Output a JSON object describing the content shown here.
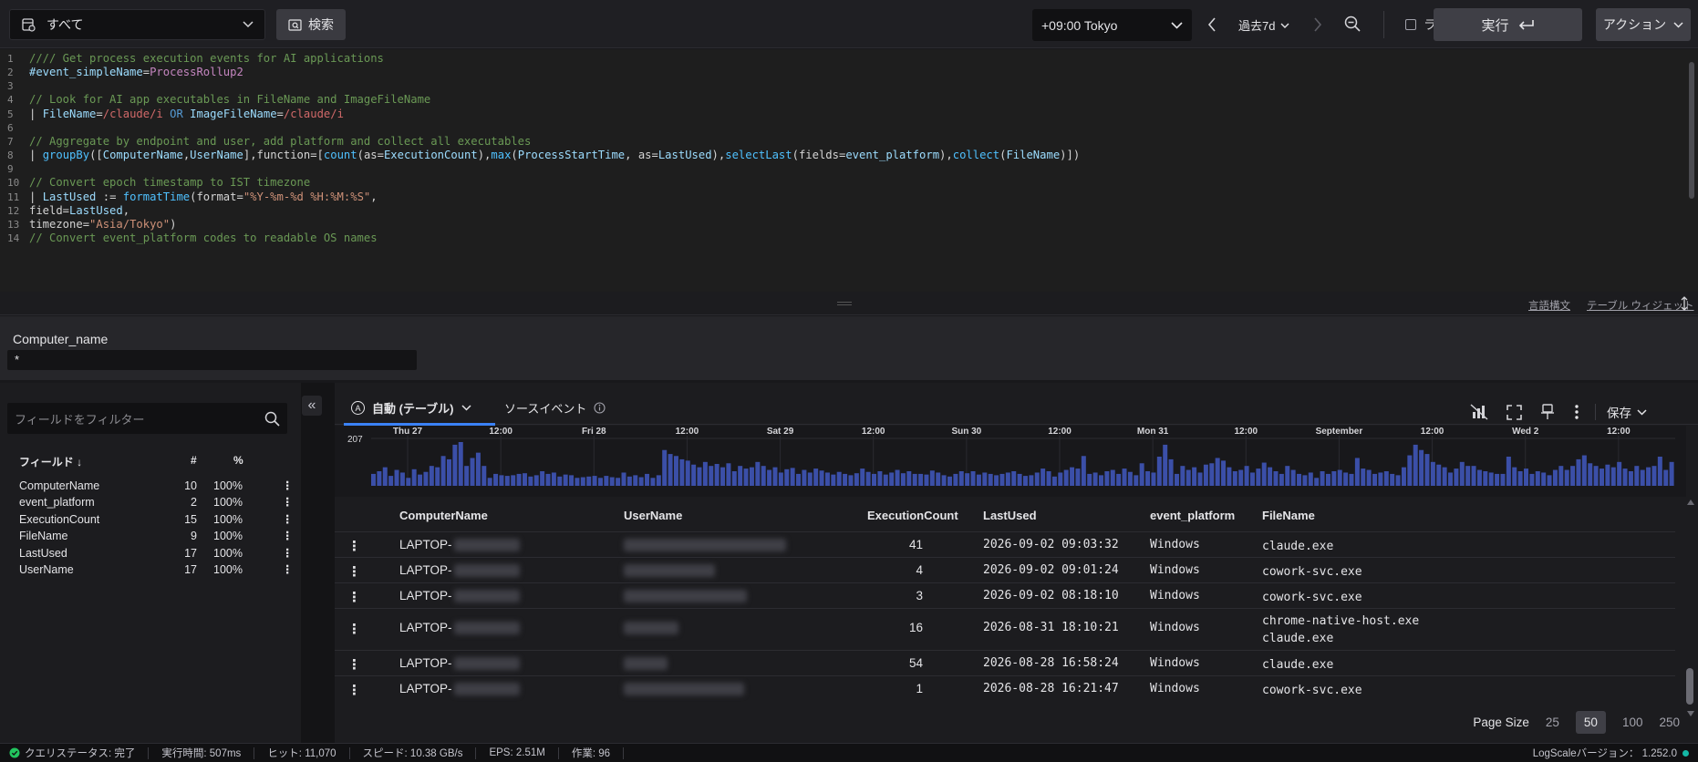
{
  "topbar": {
    "repository": "すべて",
    "search_label": "検索",
    "timezone": "+09:00 Tokyo",
    "time_range": "過去7d",
    "live_label": "ライブ",
    "run_label": "実行",
    "action_label": "アクション"
  },
  "editor": {
    "lines": [
      {
        "n": "1"
      },
      {
        "n": "2"
      },
      {
        "n": "3"
      },
      {
        "n": "4"
      },
      {
        "n": "5"
      },
      {
        "n": "6"
      },
      {
        "n": "7"
      },
      {
        "n": "8"
      },
      {
        "n": "9"
      },
      {
        "n": "10"
      },
      {
        "n": "11"
      },
      {
        "n": "12"
      },
      {
        "n": "13"
      },
      {
        "n": "14"
      }
    ],
    "code": [
      "//// Get process execution events for AI applications",
      "#event_simpleName=ProcessRollup2",
      "",
      "// Look for AI app executables in FileName and ImageFileName",
      "| FileName=/claude/i OR ImageFileName=/claude/i",
      "",
      "// Aggregate by endpoint and user, add platform and collect all executables",
      "| groupBy([ComputerName,UserName],function=[count(as=ExecutionCount),max(ProcessStartTime, as=LastUsed),selectLast(fields=event_platform),collect(FileName)])",
      "",
      "// Convert epoch timestamp to IST timezone",
      "| LastUsed := formatTime(format=\"%Y-%m-%d %H:%M:%S\",",
      "field=LastUsed,",
      "timezone=\"Asia/Tokyo\")",
      "// Convert event_platform codes to readable OS names"
    ]
  },
  "splitbar": {
    "syntax_link": "言語構文",
    "widget_link": "テーブル ウィジェット"
  },
  "parameter": {
    "label": "Computer_name",
    "value": "*"
  },
  "fields_panel": {
    "filter_placeholder": "フィールドをフィルター",
    "header_field": "フィールド ↓",
    "header_count": "#",
    "header_pct": "%",
    "fields": [
      {
        "name": "ComputerName",
        "count": "10",
        "pct": "100%"
      },
      {
        "name": "event_platform",
        "count": "2",
        "pct": "100%"
      },
      {
        "name": "ExecutionCount",
        "count": "15",
        "pct": "100%"
      },
      {
        "name": "FileName",
        "count": "9",
        "pct": "100%"
      },
      {
        "name": "LastUsed",
        "count": "17",
        "pct": "100%"
      },
      {
        "name": "UserName",
        "count": "17",
        "pct": "100%"
      }
    ]
  },
  "results": {
    "tab_auto": "自動 (テーブル)",
    "tab_auto_badge": "A",
    "tab_source": "ソースイベント",
    "save_label": "保存",
    "histogram": {
      "ymax_label": "207",
      "ticks": [
        "Thu 27",
        "12:00",
        "Fri 28",
        "12:00",
        "Sat 29",
        "12:00",
        "Sun 30",
        "12:00",
        "Mon 31",
        "12:00",
        "September",
        "12:00",
        "Wed 2",
        "12:00"
      ],
      "values": [
        18,
        22,
        28,
        15,
        24,
        20,
        12,
        25,
        17,
        21,
        30,
        28,
        45,
        40,
        62,
        66,
        30,
        42,
        50,
        30,
        12,
        18,
        16,
        15,
        16,
        18,
        19,
        14,
        16,
        22,
        18,
        20,
        14,
        17,
        16,
        12,
        13,
        14,
        15,
        12,
        15,
        13,
        12,
        20,
        14,
        16,
        13,
        18,
        12,
        16,
        54,
        48,
        45,
        40,
        38,
        32,
        28,
        36,
        30,
        33,
        28,
        34,
        22,
        30,
        26,
        28,
        36,
        30,
        24,
        28,
        20,
        25,
        27,
        18,
        24,
        20,
        26,
        23,
        20,
        17,
        21,
        18,
        16,
        19,
        26,
        21,
        18,
        22,
        17,
        20,
        24,
        19,
        22,
        18,
        18,
        17,
        23,
        20,
        16,
        14,
        18,
        22,
        19,
        22,
        17,
        20,
        18,
        16,
        18,
        20,
        22,
        18,
        15,
        16,
        20,
        26,
        22,
        14,
        20,
        24,
        28,
        26,
        45,
        18,
        20,
        16,
        22,
        24,
        18,
        26,
        21,
        16,
        34,
        22,
        20,
        44,
        62,
        40,
        18,
        30,
        24,
        28,
        20,
        32,
        34,
        42,
        38,
        28,
        22,
        24,
        30,
        20,
        26,
        35,
        28,
        22,
        18,
        30,
        24,
        18,
        16,
        20,
        12,
        22,
        18,
        22,
        24,
        20,
        18,
        42,
        26,
        24,
        18,
        20,
        22,
        18,
        16,
        28,
        46,
        62,
        54,
        48,
        36,
        32,
        28,
        20,
        26,
        36,
        30,
        30,
        24,
        22,
        20,
        18,
        18,
        44,
        28,
        22,
        26,
        18,
        22,
        20,
        16,
        24,
        30,
        24,
        30,
        40,
        46,
        34,
        30,
        26,
        32,
        28,
        36,
        26,
        22,
        30,
        24,
        28,
        30,
        44,
        24,
        36
      ]
    },
    "columns": [
      "ComputerName",
      "UserName",
      "ExecutionCount",
      "LastUsed",
      "event_platform",
      "FileName"
    ],
    "rows": [
      {
        "computer": "LAPTOP-",
        "count": "41",
        "last_used": "2026-09-02 09:03:32",
        "platform": "Windows",
        "files": [
          "claude.exe"
        ]
      },
      {
        "computer": "LAPTOP-",
        "count": "4",
        "last_used": "2026-09-02 09:01:24",
        "platform": "Windows",
        "files": [
          "cowork-svc.exe"
        ]
      },
      {
        "computer": "LAPTOP-",
        "count": "3",
        "last_used": "2026-09-02 08:18:10",
        "platform": "Windows",
        "files": [
          "cowork-svc.exe"
        ]
      },
      {
        "computer": "LAPTOP-",
        "count": "16",
        "last_used": "2026-08-31 18:10:21",
        "platform": "Windows",
        "files": [
          "chrome-native-host.exe",
          "claude.exe"
        ]
      },
      {
        "computer": "LAPTOP-",
        "count": "54",
        "last_used": "2026-08-28 16:58:24",
        "platform": "Windows",
        "files": [
          "claude.exe"
        ]
      },
      {
        "computer": "LAPTOP-",
        "count": "1",
        "last_used": "2026-08-28 16:21:47",
        "platform": "Windows",
        "files": [
          "cowork-svc.exe"
        ]
      }
    ],
    "pager": {
      "label": "Page Size",
      "options": [
        "25",
        "50",
        "100",
        "250"
      ],
      "selected": "50"
    }
  },
  "statusbar": {
    "query_status": "クエリステータス: 完了",
    "exec_time": "実行時間: 507ms",
    "hits": "ヒット: 11,070",
    "speed": "スピード: 10.38 GB/s",
    "eps": "EPS: 2.51M",
    "work": "作業: 96",
    "version": "LogScaleバージョン： 1.252.0"
  },
  "colors": {
    "accent": "#3b82f6",
    "bar": "#3b4fa8",
    "ok": "#22c55e",
    "status_dot": "#14b8a6"
  }
}
